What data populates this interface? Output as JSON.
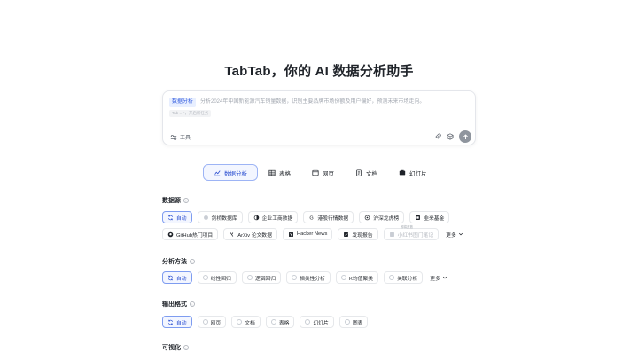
{
  "page": {
    "title": "TabTab，你的 AI 数据分析助手"
  },
  "composer": {
    "mode_tag": "数据分析",
    "placeholder": "分析2024年中国新能源汽车销量数据，识别主要品牌市场份额及用户偏好，预测未来市场走向。",
    "hint": "Tab = ‘’，开启新任务",
    "tools_label": "工具"
  },
  "tabs": [
    {
      "label": "数据分析",
      "icon": "chart-icon",
      "active": true
    },
    {
      "label": "表格",
      "icon": "table-icon"
    },
    {
      "label": "网页",
      "icon": "web-icon"
    },
    {
      "label": "文档",
      "icon": "doc-icon"
    },
    {
      "label": "幻灯片",
      "icon": "slides-icon"
    }
  ],
  "data_source": {
    "title": "数据源",
    "row1": [
      "自动",
      "剑桥数据库",
      "企业工商数据",
      "港股行情数据",
      "沪深龙虎榜",
      "韭米基金"
    ],
    "row2": [
      "GitHub热门项目",
      "ArXiv 论文数据",
      "Hacker News",
      "发现报告",
      "小红书图门笔记"
    ],
    "badge": "即将开放",
    "more": "更多"
  },
  "method": {
    "title": "分析方法",
    "items": [
      "自动",
      "线性回归",
      "逻辑回归",
      "相关性分析",
      "K均值聚类",
      "关联分析"
    ],
    "more": "更多"
  },
  "output": {
    "title": "输出格式",
    "items": [
      "自动",
      "网页",
      "文档",
      "表格",
      "幻灯片",
      "图表"
    ]
  },
  "visual": {
    "title": "可视化"
  },
  "colors": {
    "accent": "#2b4fd1",
    "accent_border": "#7e9cf0",
    "accent_bg": "#f3f6ff"
  }
}
